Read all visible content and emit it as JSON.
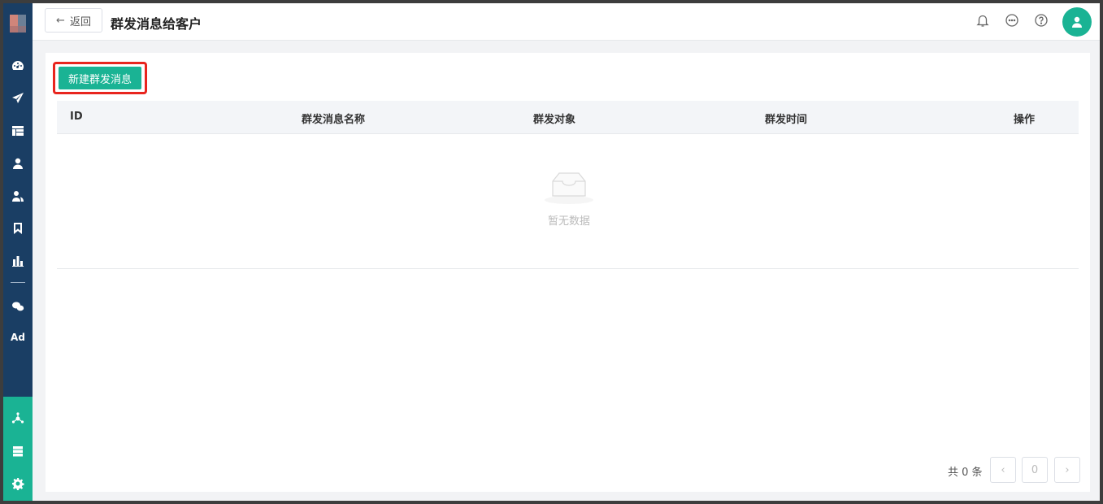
{
  "header": {
    "back_label": "返回",
    "title": "群发消息给客户"
  },
  "sidebar": {
    "items": [
      {
        "icon": "dashboard-icon"
      },
      {
        "icon": "send-icon"
      },
      {
        "icon": "layout-icon"
      },
      {
        "icon": "user-icon"
      },
      {
        "icon": "users-icon"
      },
      {
        "icon": "bookmark-icon"
      },
      {
        "icon": "bar-chart-icon"
      },
      {
        "icon": "wechat-icon"
      },
      {
        "icon": "ad-icon",
        "text": "Ad"
      }
    ],
    "bottom_items": [
      {
        "icon": "network-icon"
      },
      {
        "icon": "server-icon"
      },
      {
        "icon": "settings-icon"
      }
    ]
  },
  "toolbar": {
    "new_label": "新建群发消息"
  },
  "table": {
    "columns": [
      "ID",
      "群发消息名称",
      "群发对象",
      "群发时间",
      "操作"
    ],
    "rows": [],
    "empty_text": "暂无数据"
  },
  "pagination": {
    "total_text": "共 0 条",
    "current_page": "0",
    "prev_icon": "chevron-left-icon",
    "next_icon": "chevron-right-icon"
  },
  "colors": {
    "sidebar": "#1a3e64",
    "accent": "#1ab394",
    "highlight_border": "#e8251e"
  }
}
